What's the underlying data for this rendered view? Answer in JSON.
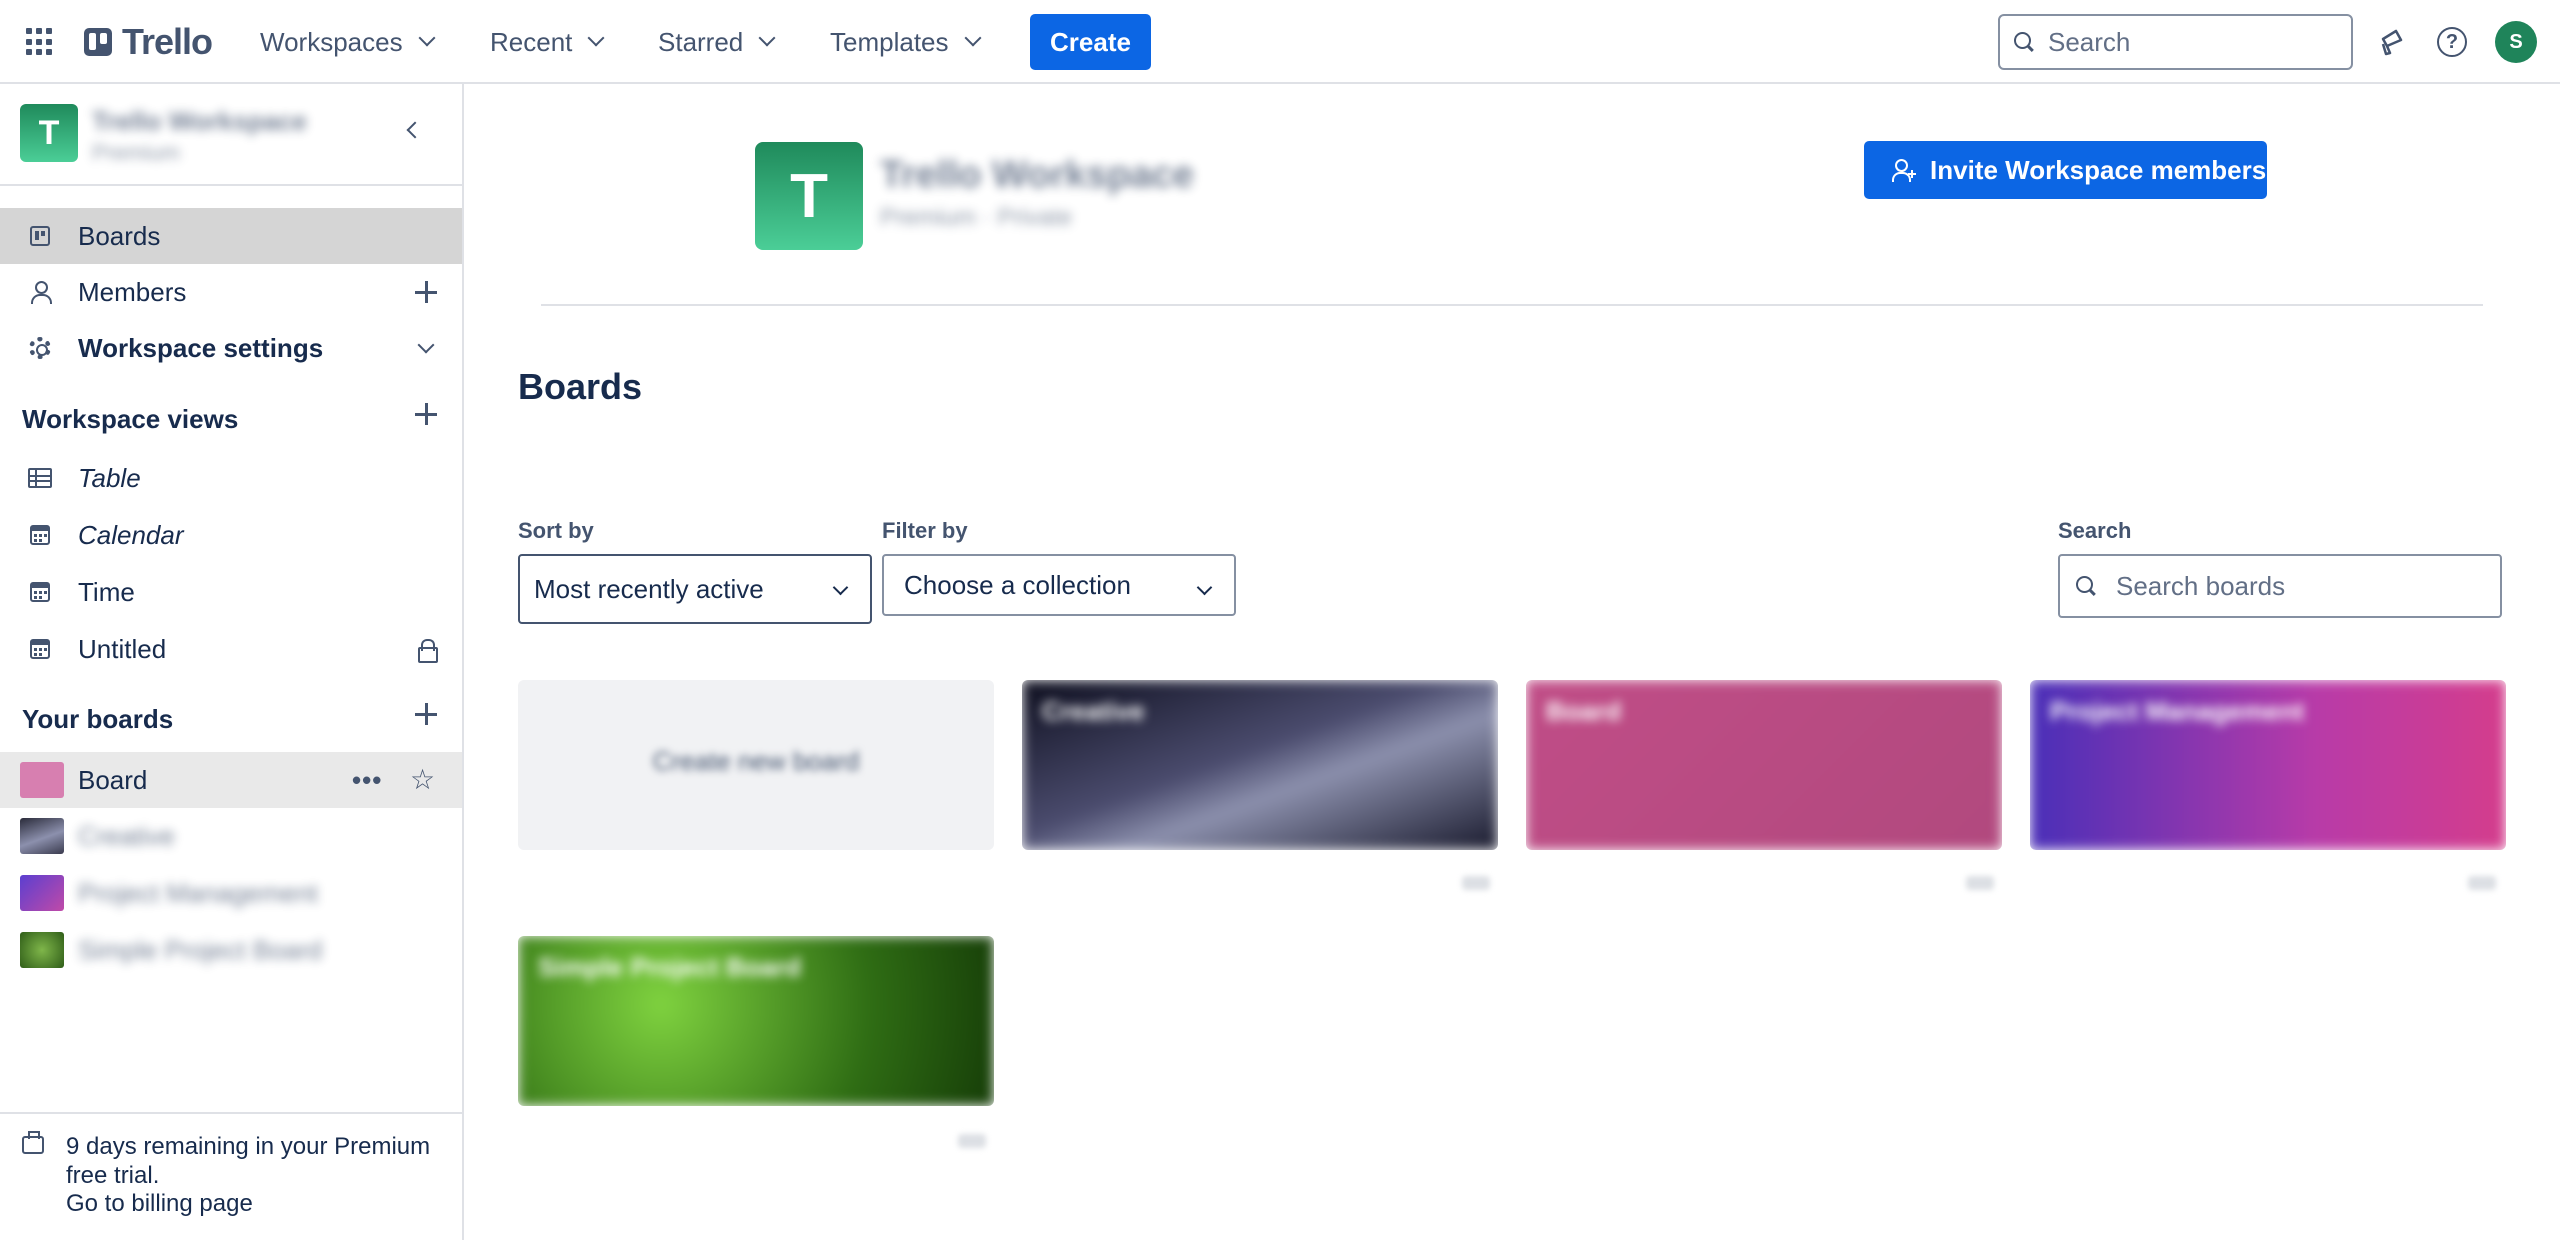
{
  "header": {
    "logo_text": "Trello",
    "nav": [
      {
        "label": "Workspaces"
      },
      {
        "label": "Recent"
      },
      {
        "label": "Starred"
      },
      {
        "label": "Templates"
      }
    ],
    "create_label": "Create",
    "search_placeholder": "Search",
    "avatar_initial": "S",
    "help_glyph": "?"
  },
  "sidebar": {
    "workspace_initial": "T",
    "workspace_name": "Trello Workspace",
    "workspace_sub": "Premium",
    "items": [
      {
        "label": "Boards"
      },
      {
        "label": "Members"
      },
      {
        "label": "Workspace settings"
      }
    ],
    "views_title": "Workspace views",
    "views": [
      {
        "label": "Table",
        "icon": "table-icon"
      },
      {
        "label": "Calendar",
        "icon": "calendar-icon"
      },
      {
        "label": "Time",
        "icon": "calendar-icon"
      },
      {
        "label": "Untitled",
        "icon": "calendar-icon"
      }
    ],
    "boards_title": "Your boards",
    "boards": [
      {
        "label": "Board",
        "color": "#d77fb0"
      },
      {
        "label": "Creative",
        "color": "#6b6f80"
      },
      {
        "label": "Project Management",
        "color": "#8a4fd0"
      },
      {
        "label": "Simple Project Board",
        "color": "#4a7a2e"
      }
    ],
    "more_glyph": "•••",
    "star_glyph": "☆",
    "trial_text": "9 days remaining in your Premium free trial.",
    "trial_link": "Go to billing page"
  },
  "main": {
    "workspace_initial": "T",
    "workspace_title": "Trello Workspace",
    "workspace_meta": "Premium · Private",
    "invite_label": "Invite Workspace members",
    "boards_title": "Boards",
    "sort_label": "Sort by",
    "sort_value": "Most recently active",
    "filter_label": "Filter by",
    "filter_value": "Choose a collection",
    "search_label": "Search",
    "search_placeholder": "Search boards",
    "create_tile_label": "Create new board",
    "tiles": [
      {
        "name": "Creative",
        "gradient": "linear-gradient(160deg,#0f1020 0%,#4b4c6e 45%,#8c90ad 60%,#1a1b2e 100%)"
      },
      {
        "name": "Board",
        "gradient": "linear-gradient(135deg,#c04d87,#b1497e)"
      },
      {
        "name": "Project Management",
        "gradient": "linear-gradient(90deg,#4a2fb8,#b83ba8 60%,#d43d8c)"
      },
      {
        "name": "Simple Project Board",
        "gradient": "radial-gradient(circle at 30% 40%,#7fd23f,#2f6d14 60%,#163d08)"
      }
    ]
  }
}
